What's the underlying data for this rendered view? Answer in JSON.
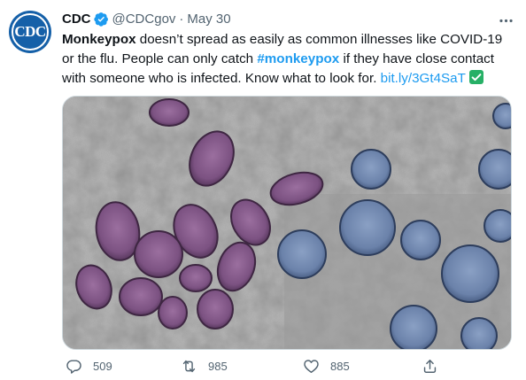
{
  "author": {
    "avatar_text": "CDC",
    "name": "CDC",
    "handle": "@CDCgov",
    "separator": "·",
    "date": "May 30"
  },
  "text": {
    "lead_bold": "Monkeypox",
    "part1": " doesn’t spread as easily as common illnesses like COVID-19 or the flu. People can only catch ",
    "hashtag": "#monkeypox",
    "part2": " if they have close contact with someone who is infected. Know what to look for. ",
    "link": "bit.ly/3Gt4SaT"
  },
  "actions": {
    "replies": "509",
    "retweets": "985",
    "likes": "885"
  },
  "icons": {
    "verified": "verified-badge-icon",
    "more": "more-options-icon",
    "check": "check-mark-emoji-icon",
    "reply": "reply-icon",
    "retweet": "retweet-icon",
    "like": "heart-icon",
    "share": "share-icon"
  },
  "colors": {
    "brand_blue": "#1d9bf0",
    "muted": "#536471",
    "text": "#0f1419",
    "cdc_blue": "#1560a8",
    "virion_purple": "#8a5f8f",
    "virion_blue": "#6f86ad"
  }
}
